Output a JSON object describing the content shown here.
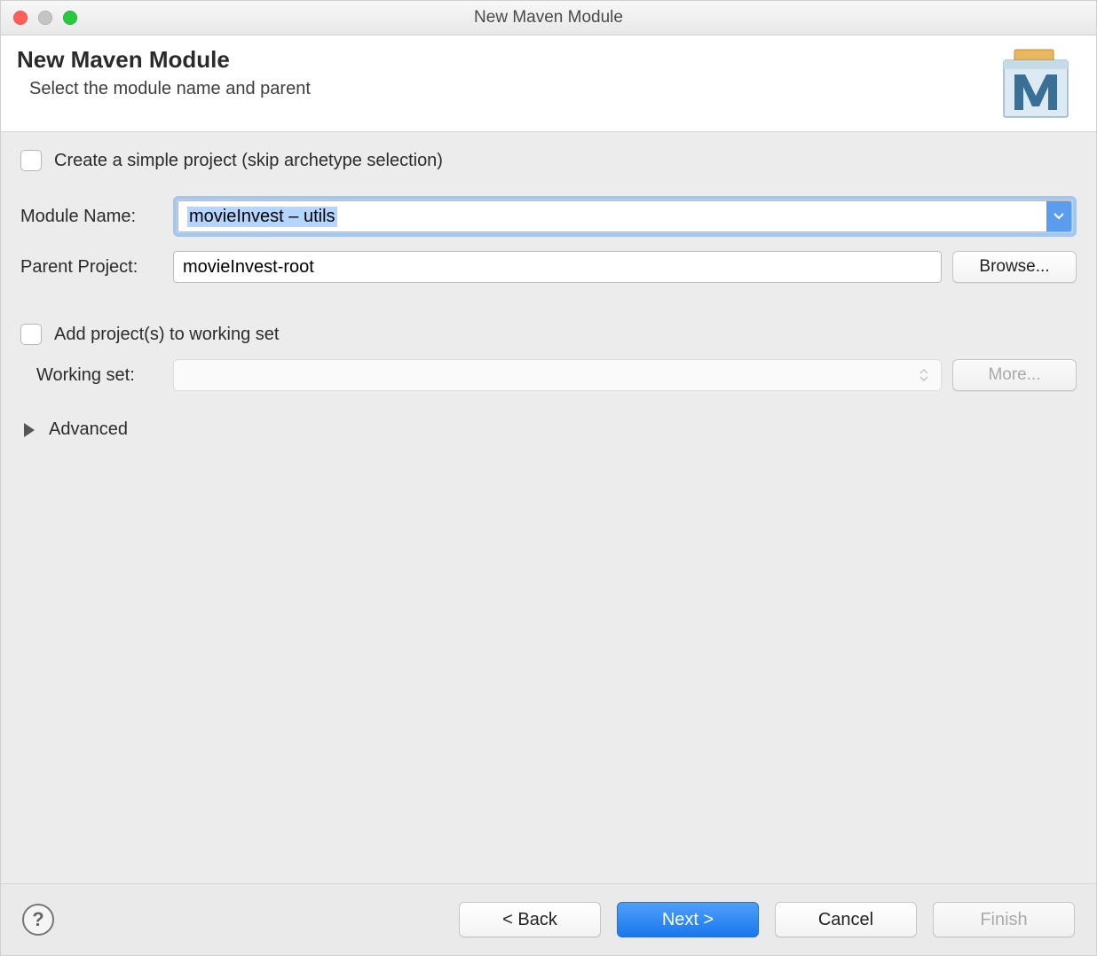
{
  "window_title": "New Maven Module",
  "header": {
    "title": "New Maven Module",
    "subtitle": "Select the module name and parent"
  },
  "form": {
    "simple_project_label": "Create a simple project (skip archetype selection)",
    "simple_project_checked": false,
    "module_name_label": "Module Name:",
    "module_name_value": "movieInvest – utils",
    "parent_project_label": "Parent Project:",
    "parent_project_value": "movieInvest-root",
    "browse_label": "Browse...",
    "add_working_set_label": "Add project(s) to working set",
    "add_working_set_checked": false,
    "working_set_label": "Working set:",
    "working_set_value": "",
    "more_label": "More...",
    "advanced_label": "Advanced"
  },
  "footer": {
    "back_label": "< Back",
    "next_label": "Next >",
    "cancel_label": "Cancel",
    "finish_label": "Finish",
    "help_tooltip": "Help"
  }
}
